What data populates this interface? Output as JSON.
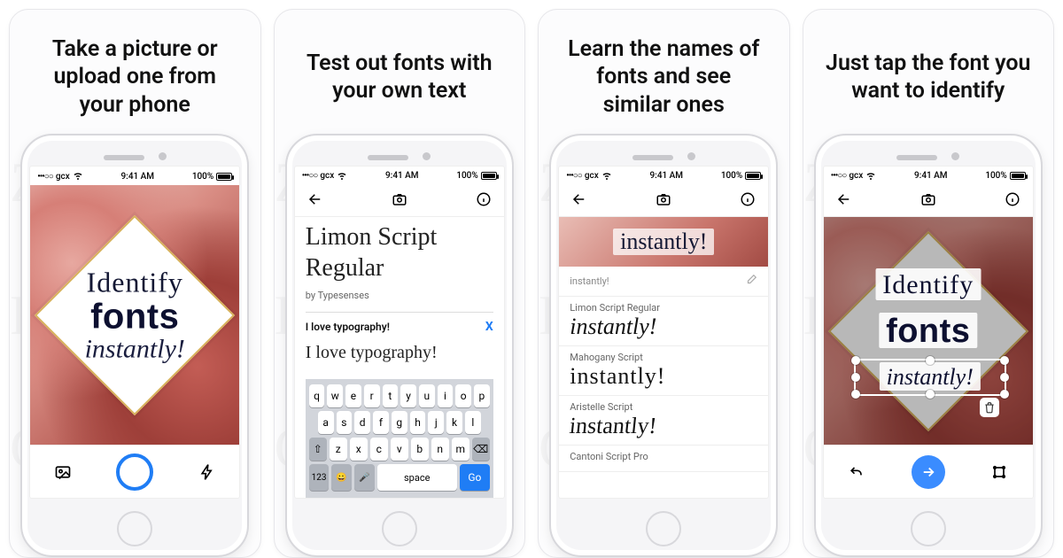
{
  "status": {
    "carrier": "gcx",
    "signal": "•••○○",
    "time": "9:41 AM",
    "battery_pct": "100%"
  },
  "panels": [
    {
      "caption": "Take a picture or\nupload one from\nyour phone",
      "hero": {
        "word1": "Identify",
        "word2": "fonts",
        "word3": "instantly!"
      },
      "toolbar": {
        "gallery_icon": "gallery-icon",
        "shutter": "shutter-button",
        "flash_icon": "flash-icon"
      }
    },
    {
      "caption": "Test out fonts with\nyour own text",
      "appbar": {
        "back": "←",
        "camera": "camera-icon",
        "info": "ⓘ"
      },
      "font_name_line1": "Limon Script",
      "font_name_line2": "Regular",
      "byline": "by Typesenses",
      "input": {
        "value": "I love typography!",
        "clear": "X"
      },
      "preview": "I love typography!",
      "keyboard": {
        "row1": [
          "q",
          "w",
          "e",
          "r",
          "t",
          "y",
          "u",
          "i",
          "o",
          "p"
        ],
        "row2": [
          "a",
          "s",
          "d",
          "f",
          "g",
          "h",
          "j",
          "k",
          "l"
        ],
        "row3_shift": "⇧",
        "row3": [
          "z",
          "x",
          "c",
          "v",
          "b",
          "n",
          "m"
        ],
        "row3_del": "⌫",
        "bottom": {
          "num": "123",
          "emoji": "😀",
          "mic": "🎤",
          "space": "space",
          "go": "Go"
        }
      }
    },
    {
      "caption": "Learn the names of\nfonts and see\nsimilar ones",
      "appbar": {
        "back": "←",
        "camera": "camera-icon",
        "info": "ⓘ"
      },
      "thumb_word": "instantly!",
      "query_label": "instantly!",
      "results": [
        {
          "name": "Limon Script Regular",
          "sample": "instantly!"
        },
        {
          "name": "Mahogany Script",
          "sample": "instantly!"
        },
        {
          "name": "Aristelle Script",
          "sample": "instantly!"
        },
        {
          "name": "Cantoni Script Pro",
          "sample": ""
        }
      ]
    },
    {
      "caption": "Just tap the font you\nwant to identify",
      "appbar": {
        "back": "←",
        "camera": "camera-icon",
        "info": "ⓘ"
      },
      "hero": {
        "word1": "Identify",
        "word2": "fonts",
        "word3": "instantly!"
      },
      "toolbar": {
        "undo_icon": "undo-icon",
        "next": "→",
        "crop_icon": "crop-icon"
      }
    }
  ]
}
